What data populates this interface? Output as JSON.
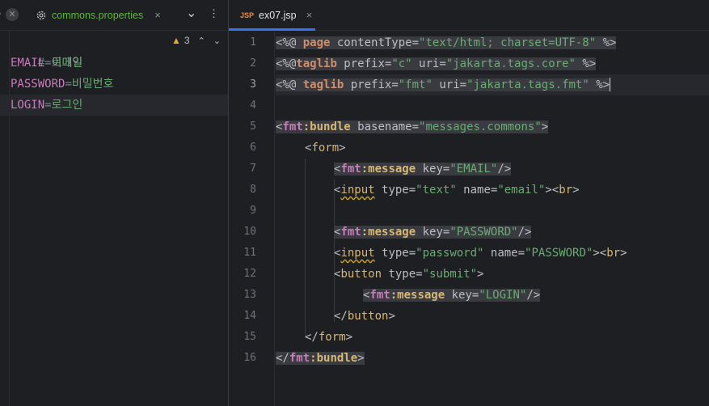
{
  "left_pane": {
    "tab": {
      "label": "commons.properties",
      "icon": "gear-icon",
      "close": "×"
    },
    "controls": {
      "chevron": "⌄",
      "more": "⋮"
    },
    "problems": {
      "count": "3"
    },
    "lines": [
      {
        "text": "# 로그인",
        "kind": "comment"
      },
      {
        "key": "EMAIL",
        "eq": "=",
        "value": "이메일"
      },
      {
        "key": "PASSWORD",
        "eq": "=",
        "value": "비밀번호"
      },
      {
        "key": "LOGIN",
        "eq": "=",
        "value": "로그인"
      }
    ]
  },
  "right_pane": {
    "tab": {
      "badge": "JSP",
      "label": "ex07.jsp",
      "close": "×"
    },
    "line_numbers": [
      "1",
      "2",
      "3",
      "4",
      "5",
      "6",
      "7",
      "8",
      "9",
      "10",
      "11",
      "12",
      "13",
      "14",
      "15",
      "16"
    ],
    "active_line": "3"
  },
  "colors": {
    "background": "#1e1f22",
    "string": "#6aab73",
    "keyword": "#cf8e6d",
    "tag": "#d5b778",
    "namespace": "#c77dbb",
    "accent": "#3574f0",
    "warning": "#e2a93a"
  },
  "code": {
    "l1": {
      "a": "<%@ ",
      "b": "page",
      "c": " contentType=",
      "d": "\"text/html; charset=UTF-8\"",
      "e": " %>"
    },
    "l2": {
      "a": "<%@",
      "b": "taglib",
      "c": " prefix=",
      "d": "\"c\"",
      "e": " uri=",
      "f": "\"jakarta.tags.core\"",
      "g": " %>"
    },
    "l3": {
      "a": "<%@",
      "b": " taglib",
      "c": " prefix=",
      "d": "\"fmt\"",
      "e": " uri=",
      "f": "\"jakarta.tags.fmt\"",
      "g": " %>"
    },
    "l5": {
      "a": "<",
      "b": "fmt",
      "c": ":bundle",
      "d": " basename=",
      "e": "\"messages.commons\"",
      "f": ">"
    },
    "l6": {
      "a": "<",
      "b": "form",
      "c": ">"
    },
    "l7": {
      "a": "<",
      "b": "fmt",
      "c": ":message",
      "d": " key=",
      "e": "\"EMAIL\"",
      "f": "/>"
    },
    "l8": {
      "a": "<",
      "b": "input",
      "c": " type=",
      "d": "\"text\"",
      "e": " name=",
      "f": "\"email\"",
      "g": "><",
      "h": "br",
      "i": ">"
    },
    "l10": {
      "a": "<",
      "b": "fmt",
      "c": ":message",
      "d": " key=",
      "e": "\"PASSWORD\"",
      "f": "/>"
    },
    "l11": {
      "a": "<",
      "b": "input",
      "c": " type=",
      "d": "\"password\"",
      "e": " name=",
      "f": "\"PASSWORD\"",
      "g": "><",
      "h": "br",
      "i": ">"
    },
    "l12": {
      "a": "<",
      "b": "button",
      "c": " type=",
      "d": "\"submit\"",
      "e": ">"
    },
    "l13": {
      "a": "<",
      "b": "fmt",
      "c": ":message",
      "d": " key=",
      "e": "\"LOGIN\"",
      "f": "/>"
    },
    "l14": {
      "a": "</",
      "b": "button",
      "c": ">"
    },
    "l15": {
      "a": "</",
      "b": "form",
      "c": ">"
    },
    "l16": {
      "a": "</",
      "b": "fmt",
      "c": ":bundle",
      "d": ">"
    }
  }
}
